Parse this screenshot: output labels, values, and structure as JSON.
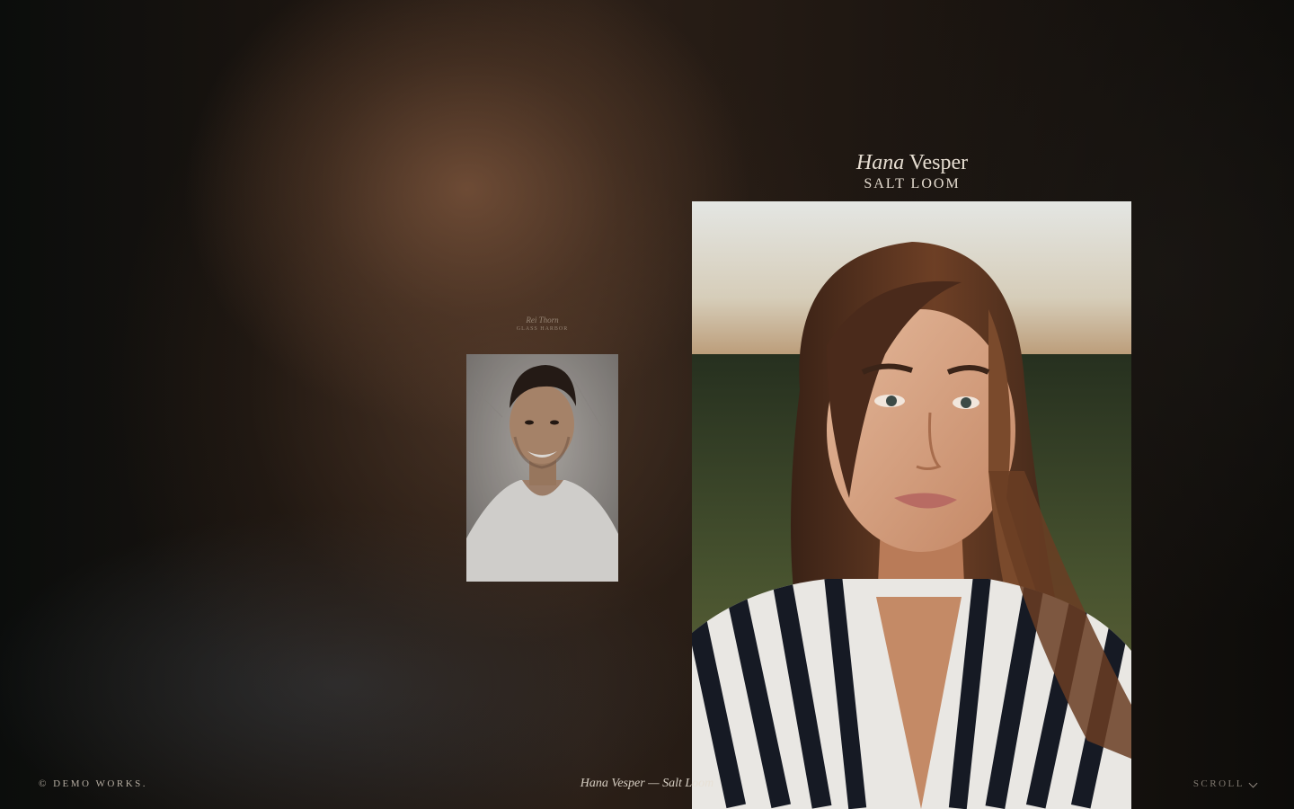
{
  "small_card": {
    "name": "Rei Thorn",
    "studio": "GLASS HARBOR",
    "photo_alt": "Portrait of a smiling man in a white v-neck t-shirt"
  },
  "large_card": {
    "first_name": "Hana",
    "last_name": "Vesper",
    "studio": "SALT LOOM",
    "photo_alt": "Portrait of a woman with long brown hair wearing a striped shirt at sunset"
  },
  "footer": {
    "copyright": "© DEMO WORKS.",
    "current_caption": "Hana Vesper — Salt Loom",
    "scroll_label": "SCROLL"
  },
  "icons": {
    "scroll": "chevron-down-icon"
  }
}
